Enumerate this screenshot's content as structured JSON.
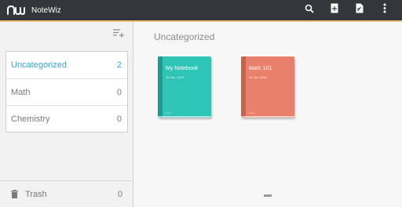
{
  "app": {
    "title": "NoteWiz"
  },
  "toolbar": {
    "actions": [
      {
        "icon": "search-icon"
      },
      {
        "icon": "new-notebook-icon"
      },
      {
        "icon": "new-note-icon"
      },
      {
        "icon": "more-vert-icon"
      }
    ]
  },
  "sidebar": {
    "sort_icon": "sort-add-icon",
    "categories": [
      {
        "label": "Uncategorized",
        "count": "2",
        "active": true
      },
      {
        "label": "Math",
        "count": "0",
        "active": false
      },
      {
        "label": "Chemistry",
        "count": "0",
        "active": false
      }
    ],
    "trash": {
      "label": "Trash",
      "count": "0",
      "icon": "trash-icon"
    }
  },
  "main": {
    "section_title": "Uncategorized",
    "notebooks": [
      {
        "title": "My Notebook",
        "date": "15 Jan, 2019",
        "label": "cover",
        "color": "#2ec4b6"
      },
      {
        "title": "Math 101",
        "date": "15 Jan, 2019",
        "label": "cover",
        "color": "#e8806b"
      }
    ]
  },
  "colors": {
    "accent": "#34a6d6",
    "appbar": "#33373a",
    "appbar_border": "#f0c27a"
  }
}
